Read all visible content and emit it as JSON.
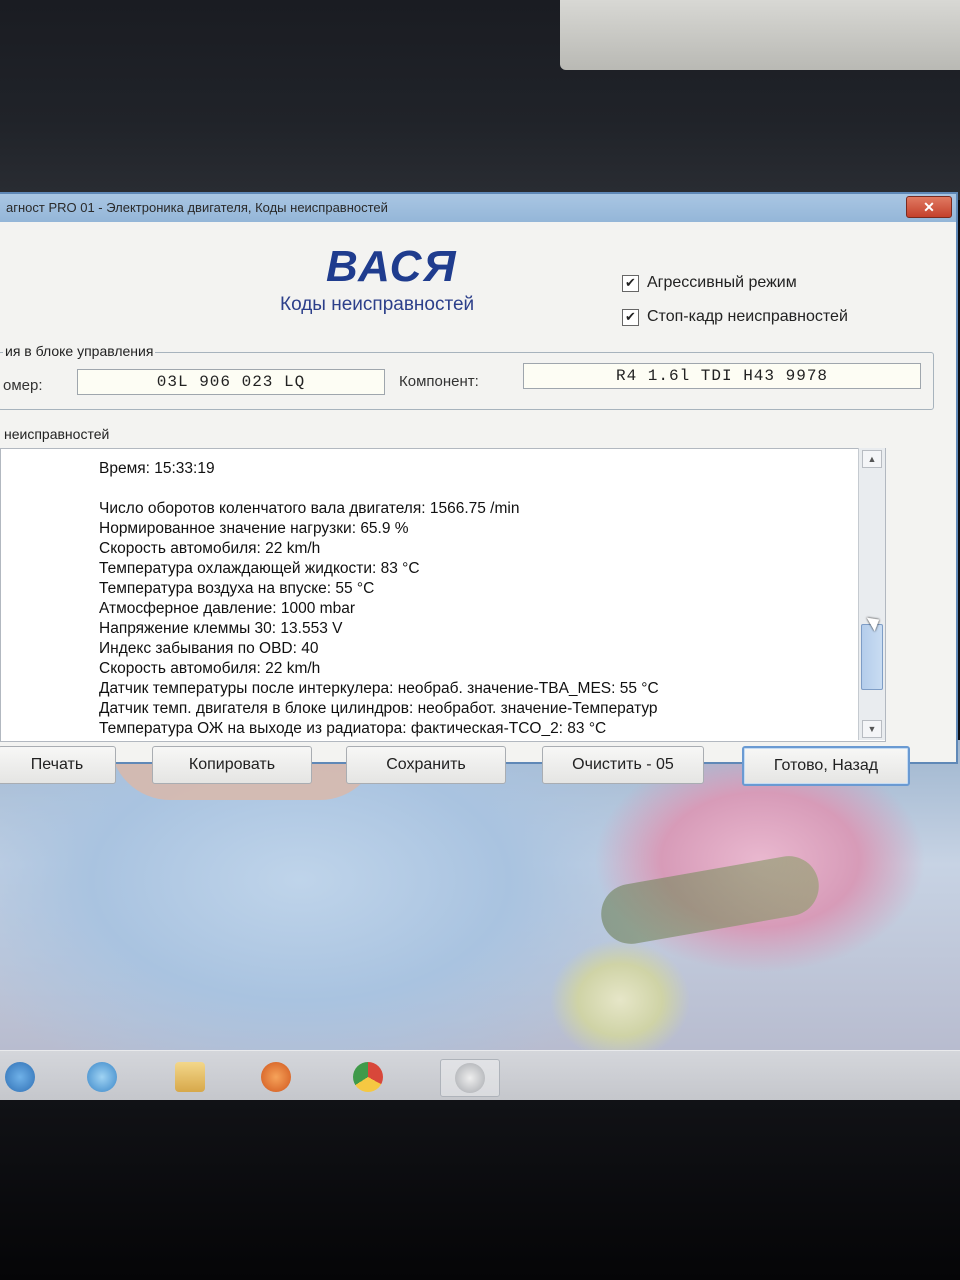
{
  "window": {
    "title": "агност PRO 01 - Электроника двигателя, Коды неисправностей",
    "close_label": "✕"
  },
  "header": {
    "logo": "ВАСЯ",
    "subtitle": "Коды неисправностей",
    "options": [
      {
        "label": "Агрессивный режим",
        "checked": true
      },
      {
        "label": "Стоп-кадр неисправностей",
        "checked": true
      }
    ]
  },
  "control_unit": {
    "legend": "ия в блоке управления",
    "part_label": "омер:",
    "part_value": "03L 906 023 LQ",
    "component_label": "Компонент:",
    "component_value": "R4 1.6l TDI    H43 9978"
  },
  "faults": {
    "legend": "неисправностей",
    "lines": [
      "Время: 15:33:19",
      "",
      "Число оборотов коленчатого вала двигателя: 1566.75 /min",
      "Нормированное значение нагрузки: 65.9 %",
      "Скорость автомобиля: 22 km/h",
      "Температура охлаждающей жидкости: 83 °C",
      "Температура воздуха на впуске: 55 °C",
      "Атмосферное давление: 1000 mbar",
      "Напряжение клеммы 30: 13.553 V",
      "Индекс забывания по OBD: 40",
      "Скорость автомобиля: 22 km/h",
      "Датчик температуры после интеркулера: необраб. значение-TBA_MES: 55 °C",
      "Датчик темп. двигателя в блоке цилиндров: необработ. значение-Температур",
      "Температура ОЖ на выходе из радиатора: фактическая-TCO_2: 83 °C"
    ]
  },
  "buttons": {
    "print": "Печать",
    "copy": "Копировать",
    "save": "Сохранить",
    "clear": "Очистить - 05",
    "done": "Готово, Назад"
  },
  "colors": {
    "window_border": "#5f88b7",
    "logo": "#1f3c8e",
    "close": "#c4402b"
  },
  "taskbar_icons": [
    "start-icon",
    "ie-icon",
    "explorer-icon",
    "media-player-icon",
    "chrome-icon",
    "vcds-icon"
  ]
}
